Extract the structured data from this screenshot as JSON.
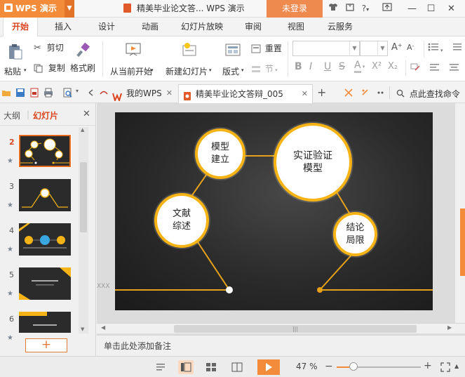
{
  "app": {
    "name": "WPS 演示",
    "doc_title": "精美毕业论文答... WPS 演示",
    "login_label": "未登录",
    "help_label": "?"
  },
  "tabs": [
    "开始",
    "插入",
    "设计",
    "动画",
    "幻灯片放映",
    "审阅",
    "视图",
    "云服务"
  ],
  "active_tab": "开始",
  "ribbon": {
    "paste": "粘贴",
    "cut": "剪切",
    "copy": "复制",
    "format_painter": "格式刷",
    "from_current": "从当前开始",
    "new_slide": "新建幻灯片",
    "layout": "版式",
    "reset": "重置",
    "section": "节",
    "font_buttons": [
      "B",
      "I",
      "U",
      "S",
      "A",
      "X²",
      "X₂"
    ]
  },
  "doc_tabs": [
    {
      "label": "我的WPS",
      "active": false
    },
    {
      "label": "精美毕业论文答辩_005",
      "active": true
    }
  ],
  "search_label": "点此查找命令",
  "left_panel": {
    "tab_outline": "大纲",
    "tab_slides": "幻灯片",
    "slides": [
      {
        "num": "2",
        "active": true,
        "star": "★"
      },
      {
        "num": "3",
        "active": false,
        "star": "★"
      },
      {
        "num": "4",
        "active": false,
        "star": "★"
      },
      {
        "num": "5",
        "active": false,
        "star": "★"
      },
      {
        "num": "6",
        "active": false,
        "star": "★"
      }
    ],
    "add_button": "+"
  },
  "slide": {
    "circles": [
      "模型\n建立",
      "实证验证\n模型",
      "文献\n综述",
      "结论\n局限"
    ],
    "side_text": "XXX"
  },
  "notes_placeholder": "单击此处添加备注",
  "status": {
    "zoom": "47 %",
    "zoom_level": 0.47
  },
  "colors": {
    "accent": "#f28b3a",
    "circle_border": "#f5b316",
    "line": "#e6a11a"
  }
}
